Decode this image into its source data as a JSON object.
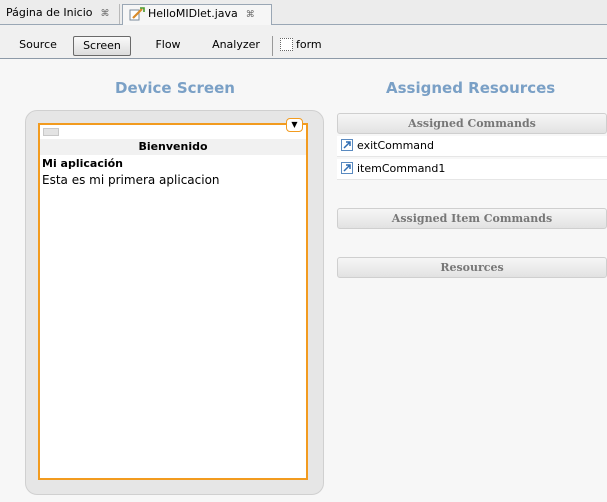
{
  "editor_tabs": [
    {
      "label": "Página de Inicio",
      "close": "⌘"
    },
    {
      "label": "HelloMIDlet.java",
      "close": "⌘"
    }
  ],
  "view_tabs": {
    "source": "Source",
    "screen": "Screen",
    "flow": "Flow",
    "analyzer": "Analyzer",
    "form": "form"
  },
  "device_screen": {
    "heading": "Device Screen",
    "title": "Bienvenido",
    "item_label": "Mi aplicación",
    "item_text": "Esta es mi primera aplicacion",
    "dropdown_icon": "▼"
  },
  "assigned_resources": {
    "heading": "Assigned Resources",
    "assigned_commands_header": "Assigned Commands",
    "commands": [
      "exitCommand",
      "itemCommand1"
    ],
    "assigned_item_commands_header": "Assigned Item Commands",
    "resources_header": "Resources"
  },
  "colors": {
    "heading_blue": "#7aa0c6",
    "device_border_orange": "#f29b1f"
  },
  "icons": {
    "java_file": "java-file-icon",
    "form": "form-icon",
    "command": "command-icon",
    "dropdown": "chevron-down-icon"
  }
}
